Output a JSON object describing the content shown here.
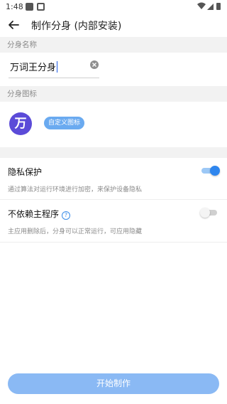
{
  "status_bar": {
    "time": "1:48"
  },
  "app_bar": {
    "title": "制作分身 (内部安装)"
  },
  "name_section": {
    "label": "分身名称",
    "value": "万词王分身"
  },
  "icon_section": {
    "label": "分身图标",
    "logo_char": "万",
    "custom_button": "自定义图标"
  },
  "settings": {
    "privacy": {
      "title": "隐私保护",
      "desc": "通过算法对运行环境进行加密，来保护设备隐私",
      "enabled": true
    },
    "independent": {
      "title": "不依赖主程序",
      "help": "?",
      "desc": "主应用删除后，分身可以正常运行，可应用隐藏",
      "enabled": false
    }
  },
  "start_button": "开始制作",
  "colors": {
    "accent": "#2f86ee",
    "button": "#8ab9f4",
    "logo": "#5b4bd8"
  }
}
